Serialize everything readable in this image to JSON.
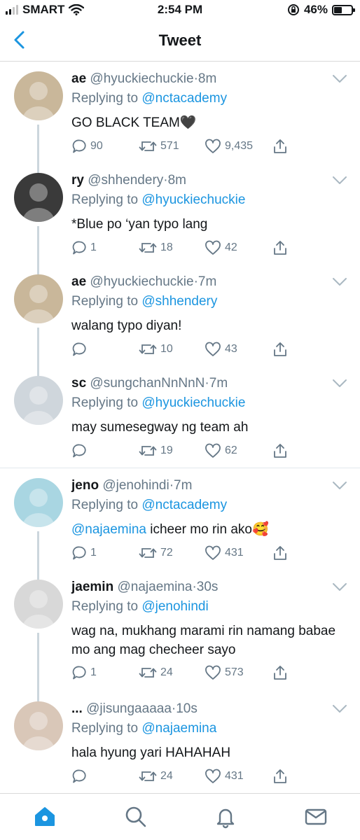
{
  "status_bar": {
    "carrier": "SMART",
    "time": "2:54 PM",
    "battery": "46%",
    "battery_level": 0.46
  },
  "nav": {
    "title": "Tweet"
  },
  "reply_prefix": "Replying to",
  "tweets": [
    {
      "name": "ae",
      "handle": "@hyuckiechuckie",
      "time": "8m",
      "replying_to": "@nctacademy",
      "text": "GO BLACK TEAM🖤",
      "mention": "",
      "replies": "90",
      "retweets": "571",
      "likes": "9,435"
    },
    {
      "name": "ry",
      "handle": "@shhendery",
      "time": "8m",
      "replying_to": "@hyuckiechuckie",
      "text": "*Blue po ‘yan typo lang",
      "mention": "",
      "replies": "1",
      "retweets": "18",
      "likes": "42"
    },
    {
      "name": "ae",
      "handle": "@hyuckiechuckie",
      "time": "7m",
      "replying_to": "@shhendery",
      "text": "walang typo diyan!",
      "mention": "",
      "replies": "",
      "retweets": "10",
      "likes": "43"
    },
    {
      "name": "sc",
      "handle": "@sungchanNnNnN",
      "time": "7m",
      "replying_to": "@hyuckiechuckie",
      "text": "may sumesegway ng team ah",
      "mention": "",
      "replies": "",
      "retweets": "19",
      "likes": "62"
    },
    {
      "name": "jeno",
      "handle": "@jenohindi",
      "time": "7m",
      "replying_to": "@nctacademy",
      "text": " icheer mo rin ako🥰",
      "mention": "@najaemina",
      "replies": "1",
      "retweets": "72",
      "likes": "431"
    },
    {
      "name": "jaemin",
      "handle": "@najaemina",
      "time": "30s",
      "replying_to": "@jenohindi",
      "text": "wag na, mukhang marami rin namang babae mo ang mag checheer sayo",
      "mention": "",
      "replies": "1",
      "retweets": "24",
      "likes": "573"
    },
    {
      "name": "...",
      "handle": "@jisungaaaaa",
      "time": "10s",
      "replying_to": "@najaemina",
      "text": "hala hyung yari HAHAHAH",
      "mention": "",
      "replies": "",
      "retweets": "24",
      "likes": "431"
    }
  ],
  "colors": {
    "accent": "#1b95e0",
    "secondary_text": "#657786",
    "thread_line": "#ccd6dd"
  }
}
